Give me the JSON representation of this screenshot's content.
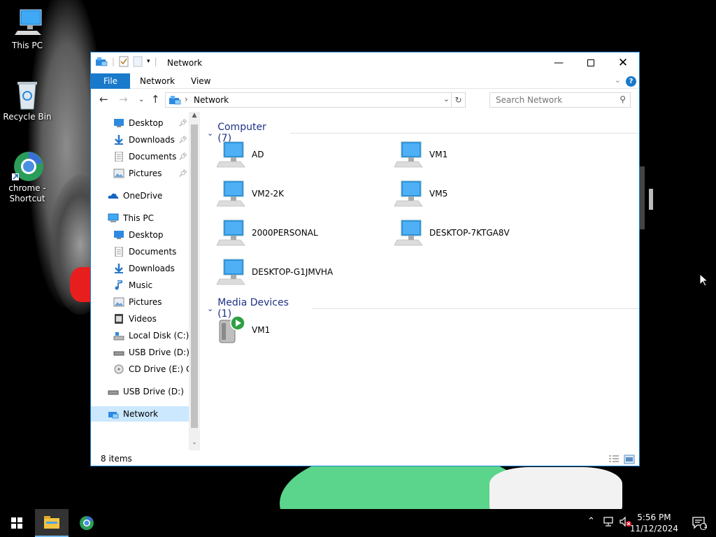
{
  "desktop": {
    "icons": [
      {
        "label": "This PC"
      },
      {
        "label": "Recycle Bin"
      },
      {
        "label": "chrome - Shortcut"
      }
    ]
  },
  "window": {
    "title": "Network",
    "ribbon_tabs": {
      "file": "File",
      "network": "Network",
      "view": "View"
    },
    "help": "?",
    "address": "Network",
    "search_placeholder": "Search Network",
    "navigation": {
      "quick_access": [
        {
          "label": "Desktop"
        },
        {
          "label": "Downloads"
        },
        {
          "label": "Documents"
        },
        {
          "label": "Pictures"
        }
      ],
      "onedrive": "OneDrive",
      "this_pc": "This PC",
      "this_pc_items": [
        {
          "label": "Desktop"
        },
        {
          "label": "Documents"
        },
        {
          "label": "Downloads"
        },
        {
          "label": "Music"
        },
        {
          "label": "Pictures"
        },
        {
          "label": "Videos"
        },
        {
          "label": "Local Disk (C:)"
        },
        {
          "label": "USB Drive (D:)"
        },
        {
          "label": "CD Drive (E:) CD"
        }
      ],
      "usb_drive": "USB Drive (D:)",
      "network": "Network"
    },
    "groups": {
      "computer": {
        "header": "Computer (7)",
        "items": [
          "AD",
          "VM1",
          "VM2-2K",
          "VM5",
          "2000PERSONAL",
          "DESKTOP-7KTGA8V",
          "DESKTOP-G1JMVHA"
        ]
      },
      "media": {
        "header": "Media Devices (1)",
        "items": [
          "VM1"
        ]
      }
    },
    "status": "8 items"
  },
  "taskbar": {
    "time": "5:56 PM",
    "date": "11/12/2024",
    "notification_count": "1"
  },
  "colors": {
    "accent": "#1979ca",
    "group_header": "#1e3287",
    "selection": "#cce8ff"
  }
}
